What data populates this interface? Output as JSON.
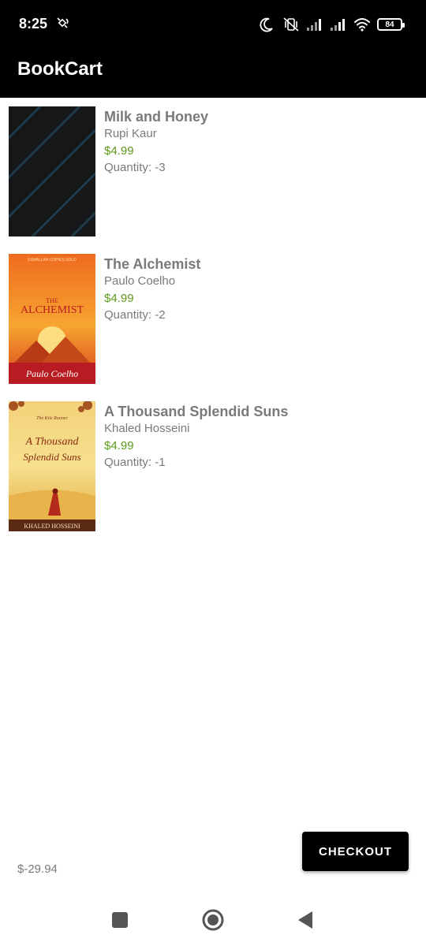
{
  "status_bar": {
    "time": "8:25",
    "battery": "84"
  },
  "app_bar": {
    "title": "BookCart"
  },
  "cart": {
    "items": [
      {
        "title": "Milk and Honey",
        "author": "Rupi Kaur",
        "price": "$4.99",
        "quantity": "Quantity: -3"
      },
      {
        "title": "The Alchemist",
        "author": "Paulo Coelho",
        "price": "$4.99",
        "quantity": "Quantity: -2"
      },
      {
        "title": "A Thousand Splendid Suns",
        "author": "Khaled Hosseini",
        "price": "$4.99",
        "quantity": "Quantity: -1"
      }
    ],
    "covers": {
      "alchemist_top": "ESHALLAN COPIES SOLD",
      "alchemist_title_1": "THE",
      "alchemist_title_2": "ALCHEMIST",
      "alchemist_author": "Paulo Coelho",
      "suns_top": "The Kite Runner",
      "suns_title_1": "A Thousand",
      "suns_title_2": "Splendid Suns",
      "suns_author": "KHALED HOSSEINI"
    }
  },
  "footer": {
    "total": "$-29.94",
    "checkout_label": "CHECKOUT"
  },
  "colors": {
    "price": "#5f9a1a",
    "text_gray": "#7a7a7a",
    "bar": "#000000"
  }
}
